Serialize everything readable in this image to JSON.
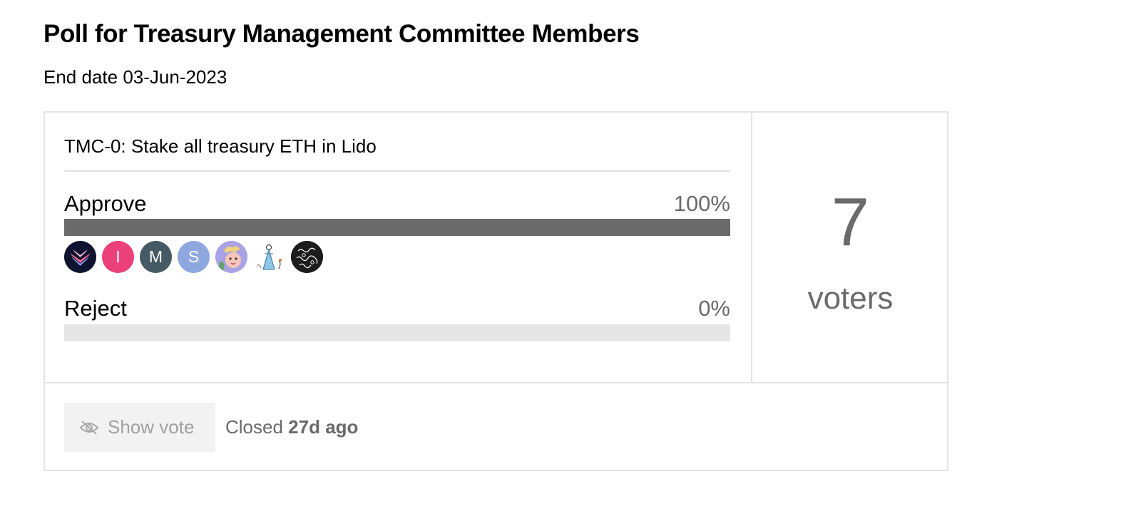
{
  "poll": {
    "title": "Poll for Treasury Management Committee Members",
    "end_date": "End date 03-Jun-2023",
    "question": "TMC-0: Stake all treasury ETH in Lido",
    "options": [
      {
        "label": "Approve",
        "percent_label": "100%",
        "percent": 100,
        "voters": [
          {
            "type": "image",
            "icon": "wings-logo-avatar",
            "color": "#0e1330"
          },
          {
            "type": "letter",
            "initial": "I",
            "color": "#ec407a"
          },
          {
            "type": "letter",
            "initial": "M",
            "color": "#455a64"
          },
          {
            "type": "letter",
            "initial": "S",
            "color": "#8ea7de"
          },
          {
            "type": "image",
            "icon": "cartoon-character-avatar",
            "color": "#a9a3e6"
          },
          {
            "type": "image",
            "icon": "figure-sketch-avatar",
            "color": "#ffffff"
          },
          {
            "type": "image",
            "icon": "puzzle-pattern-avatar",
            "color": "#1c1c1c"
          }
        ]
      },
      {
        "label": "Reject",
        "percent_label": "0%",
        "percent": 0,
        "voters": []
      }
    ],
    "voters_count": "7",
    "voters_label": "voters",
    "footer": {
      "show_vote_label": "Show vote",
      "status_prefix": "Closed",
      "status_time": "27d ago"
    }
  },
  "colors": {
    "bar_fill": "#6a6a6a",
    "bar_track": "#e6e6e6",
    "border": "#e3e3e3",
    "muted_text": "#6a6a6a"
  }
}
